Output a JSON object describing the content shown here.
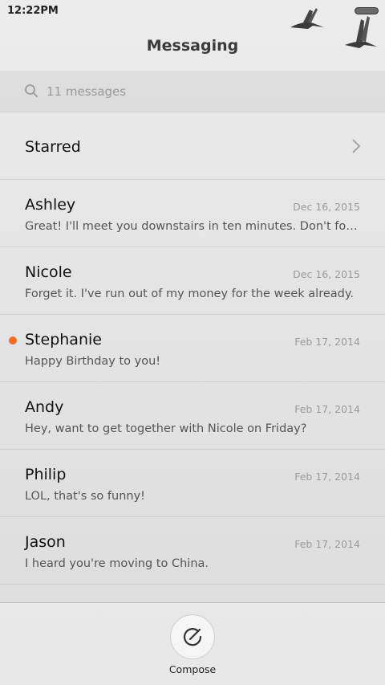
{
  "status_bar": {
    "time": "12:22PM"
  },
  "header": {
    "title": "Messaging"
  },
  "search": {
    "placeholder": "11 messages"
  },
  "starred": {
    "label": "Starred"
  },
  "threads": [
    {
      "name": "Ashley",
      "date": "Dec 16, 2015",
      "preview": "Great! I'll meet you downstairs in ten minutes. Don't forge…",
      "unread": false
    },
    {
      "name": "Nicole",
      "date": "Dec 16, 2015",
      "preview": "Forget it. I've run out of my money for the week already.",
      "unread": false
    },
    {
      "name": "Stephanie",
      "date": "Feb 17, 2014",
      "preview": "Happy Birthday to you!",
      "unread": true
    },
    {
      "name": "Andy",
      "date": "Feb 17, 2014",
      "preview": "Hey, want to get together with Nicole on Friday?",
      "unread": false
    },
    {
      "name": "Philip",
      "date": "Feb 17, 2014",
      "preview": "LOL, that's so funny!",
      "unread": false
    },
    {
      "name": "Jason",
      "date": "Feb 17, 2014",
      "preview": "I heard you're moving to China.",
      "unread": false
    }
  ],
  "bottom_bar": {
    "compose_label": "Compose"
  },
  "colors": {
    "unread_dot": "#f26b23",
    "title_text": "#3a3a3a"
  },
  "icons": {
    "search": "search-icon",
    "chevron": "chevron-right-icon",
    "compose": "compose-icon",
    "battery": "battery-icon"
  }
}
